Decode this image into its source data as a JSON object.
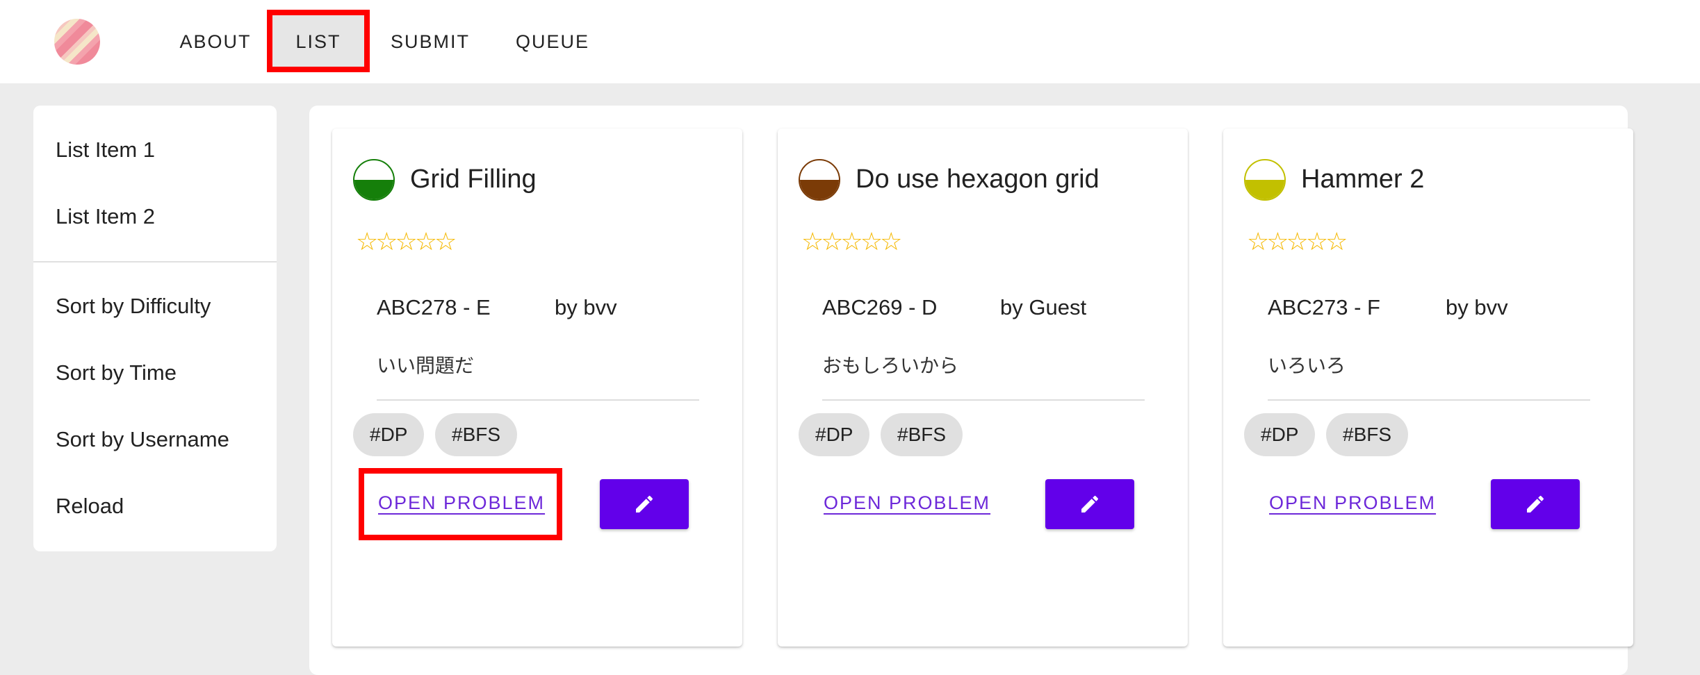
{
  "nav": {
    "about": "ABOUT",
    "list": "LIST",
    "submit": "SUBMIT",
    "queue": "QUEUE"
  },
  "sidebar": {
    "items": [
      "List Item 1",
      "List Item 2"
    ],
    "sort_items": [
      "Sort by Difficulty",
      "Sort by Time",
      "Sort by Username",
      "Reload"
    ]
  },
  "cards": [
    {
      "title": "Grid Filling",
      "difficulty_color": "#157f0a",
      "stars": "☆☆☆☆☆",
      "contest": "ABC278 - E",
      "author": "by bvv",
      "comment": "いい問題だ",
      "tags": [
        "#DP",
        "#BFS"
      ],
      "open_label": "OPEN PROBLEM"
    },
    {
      "title": "Do use hexagon grid",
      "difficulty_color": "#7b3b07",
      "stars": "☆☆☆☆☆",
      "contest": "ABC269 - D",
      "author": "by Guest",
      "comment": "おもしろいから",
      "tags": [
        "#DP",
        "#BFS"
      ],
      "open_label": "OPEN PROBLEM"
    },
    {
      "title": "Hammer 2",
      "difficulty_color": "#c2c000",
      "stars": "☆☆☆☆☆",
      "contest": "ABC273 - F",
      "author": "by bvv",
      "comment": "いろいろ",
      "tags": [
        "#DP",
        "#BFS"
      ],
      "open_label": "OPEN PROBLEM"
    }
  ],
  "colors": {
    "accent": "#6200ea",
    "link": "#6d28d9",
    "star": "#f5b800",
    "highlight": "#ff0000"
  }
}
